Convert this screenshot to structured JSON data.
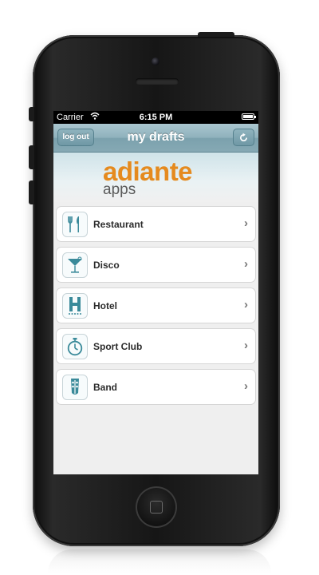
{
  "status_bar": {
    "carrier": "Carrier",
    "time": "6:15 PM"
  },
  "nav": {
    "title": "my drafts",
    "logout_label": "log out",
    "refresh_icon": "refresh-icon"
  },
  "logo": {
    "main": "adiante",
    "sub": "apps",
    "brand_color": "#e58a1e"
  },
  "menu": {
    "items": [
      {
        "label": "Restaurant",
        "icon": "utensils-icon"
      },
      {
        "label": "Disco",
        "icon": "cocktail-icon"
      },
      {
        "label": "Hotel",
        "icon": "hotel-icon"
      },
      {
        "label": "Sport Club",
        "icon": "stopwatch-icon"
      },
      {
        "label": "Band",
        "icon": "guitar-icon"
      }
    ]
  },
  "colors": {
    "nav_bar": "#8fb1bc",
    "icon_teal": "#3a8a9a",
    "background": "#efefef"
  }
}
